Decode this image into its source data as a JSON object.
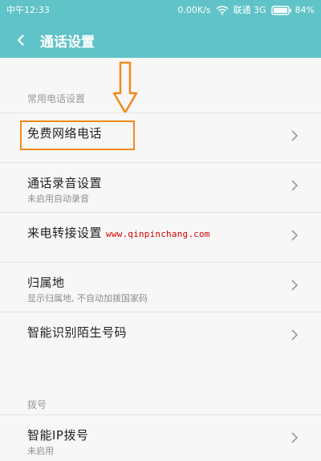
{
  "status_bar": {
    "carrier_time": "中午12:33",
    "speed": "0.00K/s",
    "network": "联通 3G",
    "battery_percent": "84%"
  },
  "header": {
    "title": "通话设置",
    "back_icon": "back-arrow-icon"
  },
  "sections": [
    {
      "label": "常用电话设置"
    },
    {
      "label": "拨号"
    }
  ],
  "rows": [
    {
      "title": "免费网络电话",
      "subtitle": ""
    },
    {
      "title": "通话录音设置",
      "subtitle": "未启用自动录音"
    },
    {
      "title": "来电转接设置",
      "subtitle": ""
    },
    {
      "title": "归属地",
      "subtitle": "显示归属地, 不自动加拨国家码"
    },
    {
      "title": "智能识别陌生号码",
      "subtitle": ""
    },
    {
      "title": "智能IP拨号",
      "subtitle": "未启用"
    }
  ],
  "overlay": {
    "watermark": "www.qinpinchang.com",
    "highlight_color": "#f08a1c",
    "watermark_color": "#d40000"
  },
  "colors": {
    "header_bg": "#5fc3c7"
  }
}
